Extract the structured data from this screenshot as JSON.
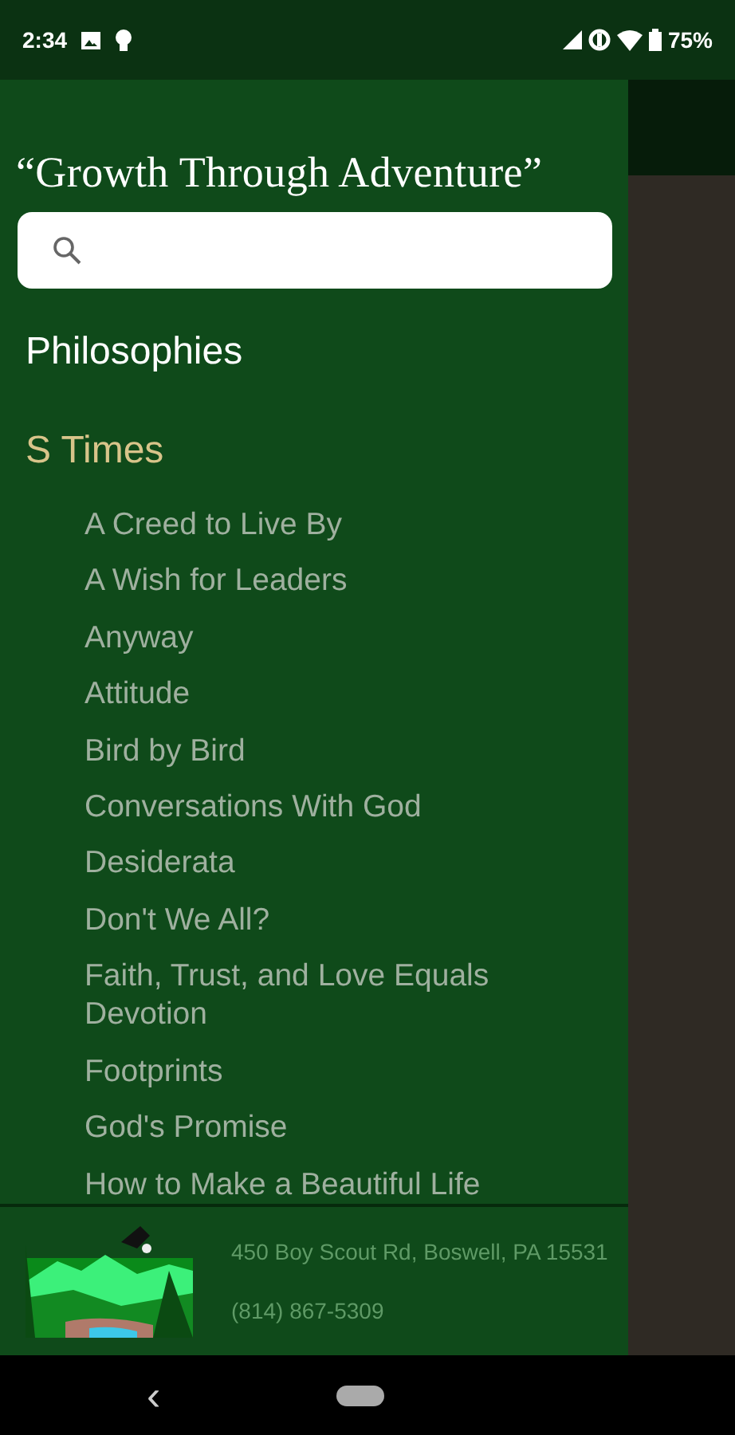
{
  "status_bar": {
    "time": "2:34",
    "battery": "75%"
  },
  "drawer": {
    "title": "“Growth Through Adventure”",
    "groups": [
      {
        "label": "Philosophies",
        "expanded": false
      },
      {
        "label": "S Times",
        "expanded": true,
        "children": [
          {
            "label": "A Creed to Live By"
          },
          {
            "label": "A Wish for Leaders"
          },
          {
            "label": "Anyway"
          },
          {
            "label": "Attitude"
          },
          {
            "label": "Bird by Bird"
          },
          {
            "label": "Conversations With God"
          },
          {
            "label": "Desiderata"
          },
          {
            "label": "Don't We All?"
          },
          {
            "label": "Faith, Trust, and Love Equals Devotion"
          },
          {
            "label": "Footprints"
          },
          {
            "label": "God's Promise"
          },
          {
            "label": "How to Make a Beautiful Life"
          }
        ]
      }
    ],
    "footer": {
      "address": "450 Boy Scout Rd, Boswell, PA 15531",
      "phone": "(814) 867-5309"
    }
  },
  "nav_bar": {
    "back": "‹"
  }
}
